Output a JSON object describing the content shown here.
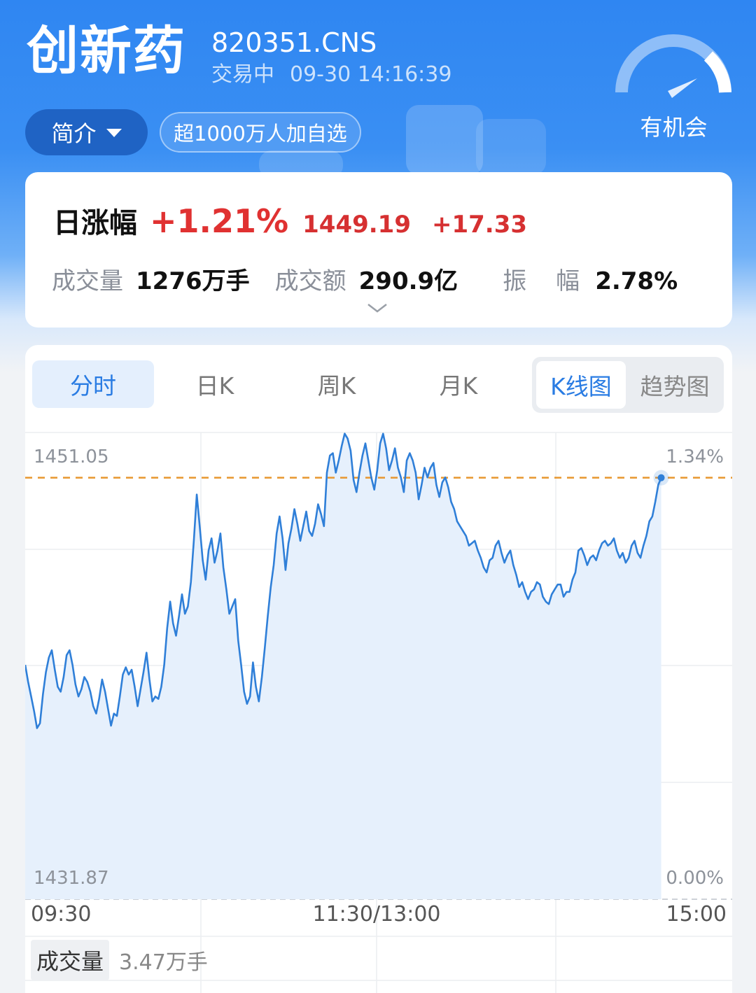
{
  "header": {
    "title": "创新药",
    "code": "820351.CNS",
    "trade_state": "交易中",
    "datetime": "09-30 14:16:39",
    "intro_label": "简介",
    "watch_count_label": "超1000万人加自选",
    "gauge_label": "有机会"
  },
  "summary": {
    "daily_change_label": "日涨幅",
    "daily_change_pct": "+1.21%",
    "price": "1449.19",
    "change_amount": "+17.33",
    "volume_label": "成交量",
    "volume_value": "1276万手",
    "turnover_label": "成交额",
    "turnover_value": "290.9亿",
    "amplitude_label": "振　幅",
    "amplitude_value": "2.78%"
  },
  "chart_tabs": {
    "items": [
      "分时",
      "日K",
      "周K",
      "月K"
    ],
    "active_index": 0,
    "toggle_on": "K线图",
    "toggle_off": "趋势图"
  },
  "chart_data": {
    "type": "area",
    "y_left_top_label": "1451.05",
    "y_left_bottom_label": "1431.87",
    "y_right_top_label": "1.34%",
    "y_right_bottom_label": "0.00%",
    "x_tick_labels": [
      "09:30",
      "11:30/13:00",
      "15:00"
    ],
    "ylim": [
      1431.87,
      1451.05
    ],
    "reference_price": 1449.19,
    "total_slots": 240,
    "values": [
      1441.5,
      1440.8,
      1440.2,
      1439.6,
      1438.9,
      1439.1,
      1440.3,
      1441.2,
      1441.8,
      1442.1,
      1441.3,
      1440.6,
      1440.4,
      1441.0,
      1441.9,
      1442.1,
      1441.5,
      1440.7,
      1440.2,
      1440.5,
      1441.0,
      1440.8,
      1440.4,
      1439.8,
      1439.5,
      1440.1,
      1440.9,
      1440.4,
      1439.7,
      1439.0,
      1439.5,
      1439.4,
      1440.2,
      1441.1,
      1441.4,
      1441.1,
      1441.3,
      1440.6,
      1439.8,
      1440.5,
      1441.2,
      1442.0,
      1440.9,
      1440.0,
      1440.2,
      1440.1,
      1440.6,
      1441.5,
      1443.0,
      1444.1,
      1443.2,
      1442.7,
      1443.5,
      1444.4,
      1443.6,
      1443.9,
      1444.9,
      1446.6,
      1448.5,
      1447.2,
      1445.8,
      1445.0,
      1446.2,
      1446.7,
      1445.7,
      1446.2,
      1446.9,
      1445.5,
      1444.6,
      1443.6,
      1443.9,
      1444.2,
      1442.5,
      1441.5,
      1440.4,
      1439.9,
      1440.2,
      1441.6,
      1440.6,
      1440.0,
      1441.0,
      1442.2,
      1443.5,
      1444.7,
      1445.6,
      1446.9,
      1447.6,
      1446.7,
      1445.4,
      1446.5,
      1447.1,
      1447.9,
      1447.3,
      1446.6,
      1447.2,
      1447.8,
      1447.0,
      1446.8,
      1447.3,
      1448.1,
      1447.7,
      1447.2,
      1449.4,
      1450.1,
      1450.2,
      1449.4,
      1449.9,
      1450.5,
      1451.0,
      1450.8,
      1450.3,
      1449.1,
      1448.6,
      1449.4,
      1450.1,
      1450.6,
      1449.9,
      1449.2,
      1448.7,
      1449.5,
      1450.6,
      1451.0,
      1450.4,
      1449.5,
      1449.9,
      1450.4,
      1449.6,
      1449.2,
      1448.6,
      1449.9,
      1450.2,
      1449.9,
      1449.4,
      1448.3,
      1448.9,
      1449.6,
      1449.2,
      1449.6,
      1449.8,
      1448.9,
      1448.4,
      1449.0,
      1449.2,
      1448.8,
      1448.2,
      1447.9,
      1447.4,
      1447.2,
      1447.0,
      1446.8,
      1446.4,
      1446.5,
      1446.6,
      1446.2,
      1445.9,
      1445.5,
      1445.3,
      1445.8,
      1445.9,
      1446.4,
      1446.6,
      1446.1,
      1445.7,
      1446.0,
      1446.2,
      1445.6,
      1445.2,
      1444.7,
      1444.9,
      1444.5,
      1444.2,
      1444.5,
      1444.6,
      1444.9,
      1444.8,
      1444.3,
      1444.1,
      1444.0,
      1444.4,
      1444.6,
      1444.8,
      1444.8,
      1444.3,
      1444.5,
      1444.5,
      1445.0,
      1445.3,
      1446.2,
      1446.3,
      1446.0,
      1445.6,
      1445.9,
      1446.0,
      1445.8,
      1446.2,
      1446.5,
      1446.6,
      1446.4,
      1446.5,
      1446.7,
      1446.2,
      1445.9,
      1446.1,
      1445.7,
      1445.9,
      1446.4,
      1446.6,
      1446.1,
      1445.9,
      1446.4,
      1446.8,
      1447.4,
      1447.6,
      1448.2,
      1448.9,
      1449.19
    ]
  },
  "volume": {
    "label": "成交量",
    "value": "3.47万手"
  },
  "colors": {
    "brand_blue": "#2a7ce3",
    "up_red": "#e03131",
    "line_blue": "#2f7fd8",
    "ref_line_orange": "#e8962e"
  }
}
